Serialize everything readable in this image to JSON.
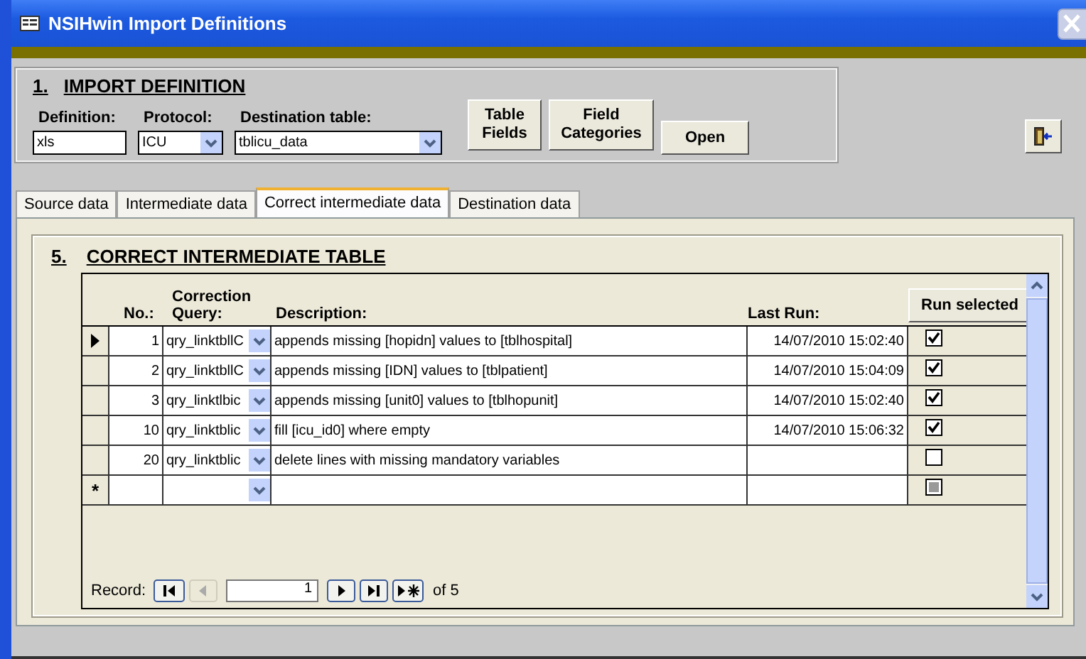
{
  "window": {
    "title": "NSIHwin Import Definitions"
  },
  "import_definition": {
    "number": "1.",
    "heading": "IMPORT DEFINITION",
    "fields": [
      {
        "label": "Definition:",
        "value": "xls",
        "kind": "text"
      },
      {
        "label": "Protocol:",
        "value": "ICU",
        "kind": "dropdown"
      },
      {
        "label": "Destination table:",
        "value": "tblicu_data",
        "kind": "dropdown"
      }
    ],
    "buttons": [
      "Table Fields",
      "Field Categories",
      "Open"
    ]
  },
  "tabs": [
    {
      "label": "Source data",
      "selected": false
    },
    {
      "label": "Intermediate data",
      "selected": false
    },
    {
      "label": "Correct intermediate data",
      "selected": true
    },
    {
      "label": "Destination data",
      "selected": false
    }
  ],
  "section": {
    "number": "5.",
    "heading": "CORRECT INTERMEDIATE TABLE",
    "columns": [
      "No.:",
      "Correction Query:",
      "Description:",
      "Last Run:"
    ],
    "run_button": "Run selected",
    "rows": [
      {
        "no": "1",
        "query": "qry_linktbllC",
        "description": "appends missing [hopidn] values to [tblhospital]",
        "last_run": "14/07/2010 15:02:40",
        "checked": true,
        "selected": true
      },
      {
        "no": "2",
        "query": "qry_linktbllC",
        "description": "appends missing [IDN] values to [tblpatient]",
        "last_run": "14/07/2010 15:04:09",
        "checked": true,
        "selected": false
      },
      {
        "no": "3",
        "query": "qry_linktlbic",
        "description": "appends missing [unit0] values to [tblhopunit]",
        "last_run": "14/07/2010 15:02:40",
        "checked": true,
        "selected": false
      },
      {
        "no": "10",
        "query": "qry_linktblic",
        "description": "fill [icu_id0] where empty",
        "last_run": "14/07/2010 15:06:32",
        "checked": true,
        "selected": false
      },
      {
        "no": "20",
        "query": "qry_linktblic",
        "description": "delete lines with missing mandatory variables",
        "last_run": "",
        "checked": false,
        "selected": false
      }
    ],
    "new_row": {
      "marker": "*",
      "indeterminate": true
    },
    "navigator": {
      "label": "Record:",
      "current": "1",
      "total": "of 5"
    }
  }
}
